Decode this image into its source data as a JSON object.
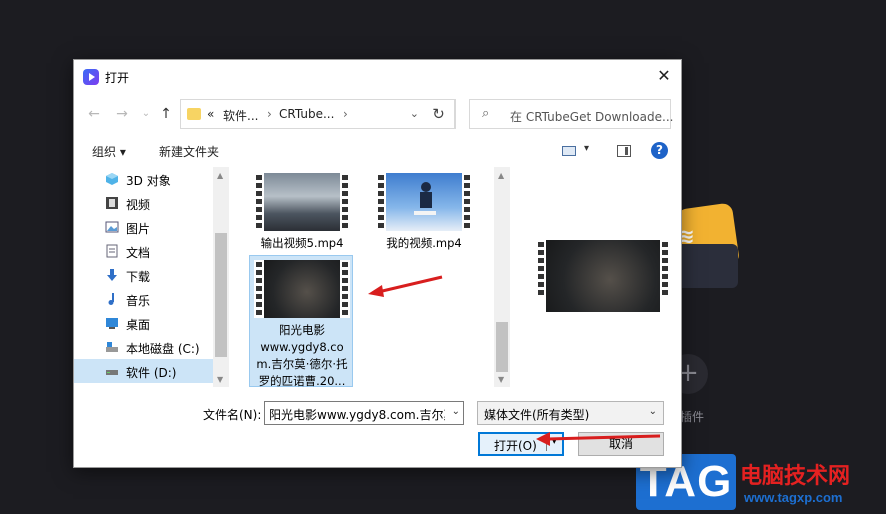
{
  "background": {
    "plugin_label": "插件",
    "plus": "+"
  },
  "watermark": {
    "tag": "TAG",
    "title": "电脑技术网",
    "url": "www.tagxp.com"
  },
  "dialog": {
    "title": "打开",
    "close": "✕",
    "nav": {
      "back": "←",
      "forward": "→",
      "recent": "⌄",
      "up": "↑"
    },
    "address": {
      "prefix": "«",
      "segments": [
        "软件...",
        "CRTube..."
      ],
      "separator": "›",
      "dropdown": "⌄"
    },
    "refresh": "↻",
    "search_placeholder": "在 CRTubeGet Downloade...",
    "toolbar": {
      "organize": "组织 ▾",
      "new_folder": "新建文件夹",
      "view_dropdown": "▾",
      "help": "?"
    },
    "sidebar": [
      {
        "label": "3D 对象",
        "icon": "3d-objects-icon"
      },
      {
        "label": "视频",
        "icon": "video-icon"
      },
      {
        "label": "图片",
        "icon": "pictures-icon"
      },
      {
        "label": "文档",
        "icon": "documents-icon"
      },
      {
        "label": "下载",
        "icon": "downloads-icon"
      },
      {
        "label": "音乐",
        "icon": "music-icon"
      },
      {
        "label": "桌面",
        "icon": "desktop-icon"
      },
      {
        "label": "本地磁盘 (C:)",
        "icon": "local-disk-icon"
      },
      {
        "label": "软件 (D:)",
        "icon": "drive-icon"
      }
    ],
    "files": [
      {
        "name": "输出视频5.mp4"
      },
      {
        "name": "我的视频.mp4"
      },
      {
        "name": "阳光电影www.ygdy8.com.吉尔莫·德尔·托罗的匹诺曹.20...",
        "lines": [
          "阳光电影",
          "www.ygdy8.co",
          "m.吉尔莫·德尔·托",
          "罗的匹诺曹.20..."
        ]
      }
    ],
    "filename_label": "文件名(N):",
    "filename_value": "阳光电影www.ygdy8.com.吉尔莫",
    "filetype": "媒体文件(所有类型)",
    "open_button": "打开(O)",
    "cancel_button": "取消",
    "colors": {
      "accent": "#0078d7",
      "selection": "#cce4f7",
      "arrow": "#d81e1e"
    }
  }
}
